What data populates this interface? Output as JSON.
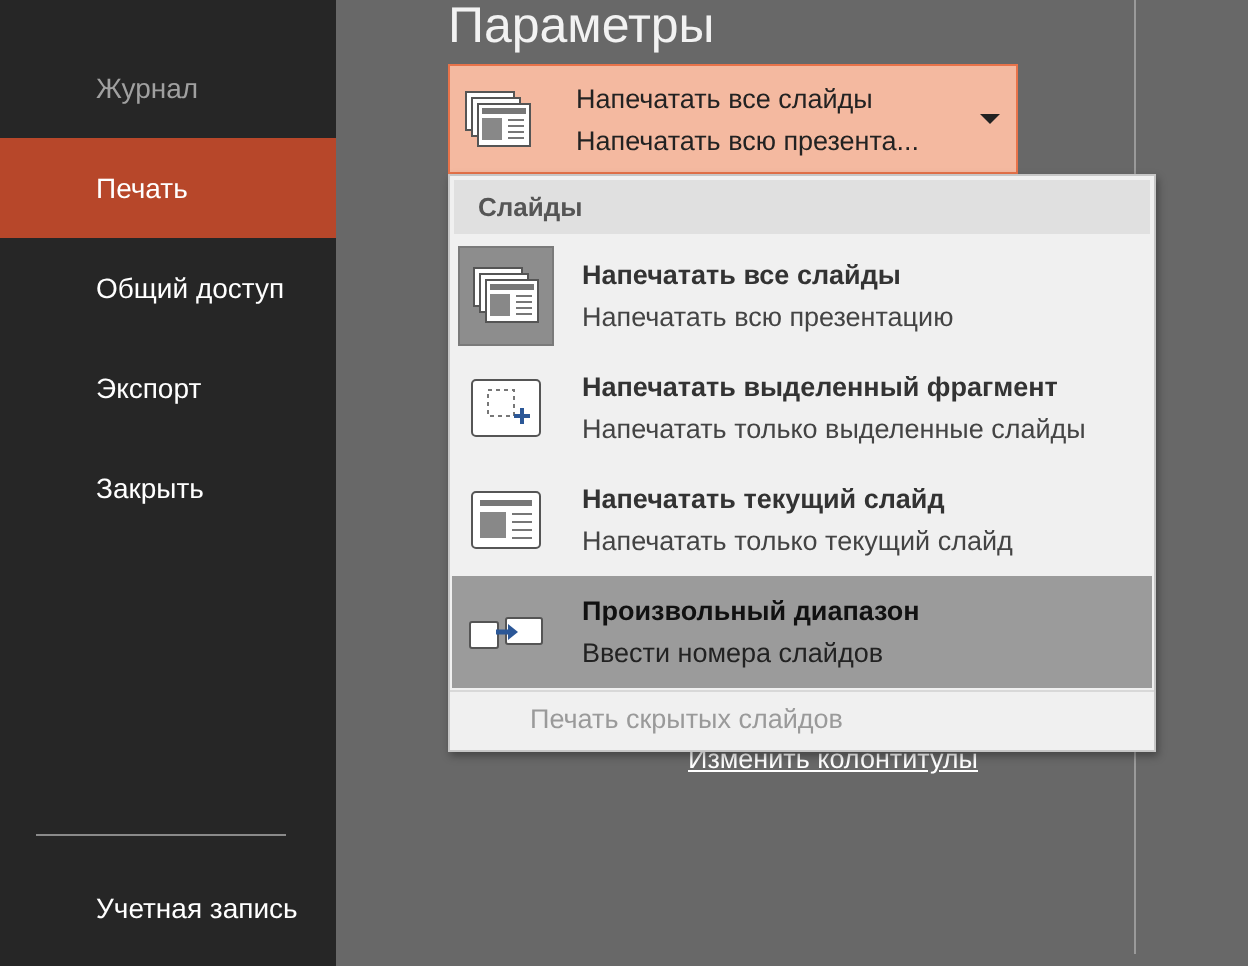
{
  "sidebar": {
    "items": [
      {
        "label": "Журнал",
        "selected": false,
        "disabled": true
      },
      {
        "label": "Печать",
        "selected": true,
        "disabled": false
      },
      {
        "label": "Общий доступ",
        "selected": false,
        "disabled": false
      },
      {
        "label": "Экспорт",
        "selected": false,
        "disabled": false
      },
      {
        "label": "Закрыть",
        "selected": false,
        "disabled": false
      }
    ],
    "footer_items": [
      {
        "label": "Учетная запись",
        "selected": false,
        "disabled": false
      }
    ]
  },
  "main": {
    "title": "Параметры",
    "slides_dropdown": {
      "title": "Напечатать все слайды",
      "subtitle": "Напечатать всю презента...",
      "kind": "all",
      "expanded": true
    },
    "footer_link": "Изменить колонтитулы",
    "menu": {
      "header": "Слайды",
      "items": [
        {
          "kind": "all",
          "title": "Напечатать все слайды",
          "subtitle": "Напечатать всю презентацию",
          "selected": true,
          "hovered": false
        },
        {
          "kind": "selection",
          "title": "Напечатать выделенный фрагмент",
          "subtitle": "Напечатать только выделенные слайды",
          "selected": false,
          "hovered": false
        },
        {
          "kind": "current",
          "title": "Напечатать текущий слайд",
          "subtitle": "Напечатать только текущий слайд",
          "selected": false,
          "hovered": false
        },
        {
          "kind": "range",
          "title": "Произвольный диапазон",
          "subtitle": "Ввести номера слайдов",
          "selected": false,
          "hovered": true
        }
      ],
      "option": {
        "label": "Печать скрытых слайдов",
        "disabled": true
      }
    }
  }
}
